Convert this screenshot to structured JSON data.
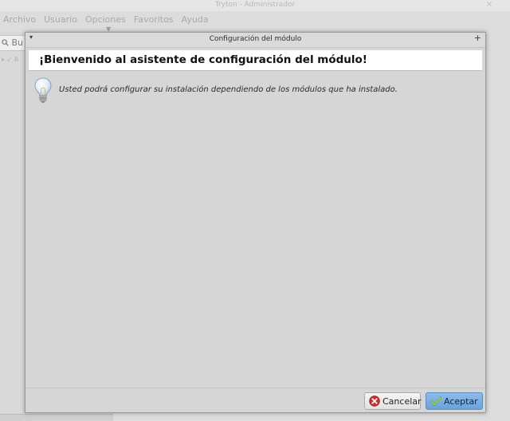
{
  "background_window": {
    "title": "Tryton - Administrador",
    "close_glyph": "×",
    "menu": [
      "Archivo",
      "Usuario",
      "Opciones",
      "Favoritos",
      "Ayuda"
    ],
    "tab_arrow_glyph": "▼",
    "search_text": "Bu",
    "tree_text": "▸ ↙ A"
  },
  "dialog": {
    "title": "Configuración del módulo",
    "menu_glyph": "▾",
    "maximize_glyph": "+",
    "header": "¡Bienvenido al asistente de configuración del módulo!",
    "info_icon": "lightbulb-icon",
    "info_text": "Usted podrá configurar su instalación dependiendo de los módulos que ha instalado.",
    "buttons": {
      "cancel_label": "Cancelar",
      "cancel_icon": "cancel-icon",
      "ok_label": "Aceptar",
      "ok_icon": "checkmark-icon"
    }
  },
  "colors": {
    "dialog_background": "#d6d6d6",
    "header_background": "#ffffff",
    "ok_button": "#7aaee2",
    "cancel_icon_red": "#d32f2f",
    "checkmark_green": "#6ab62a"
  }
}
